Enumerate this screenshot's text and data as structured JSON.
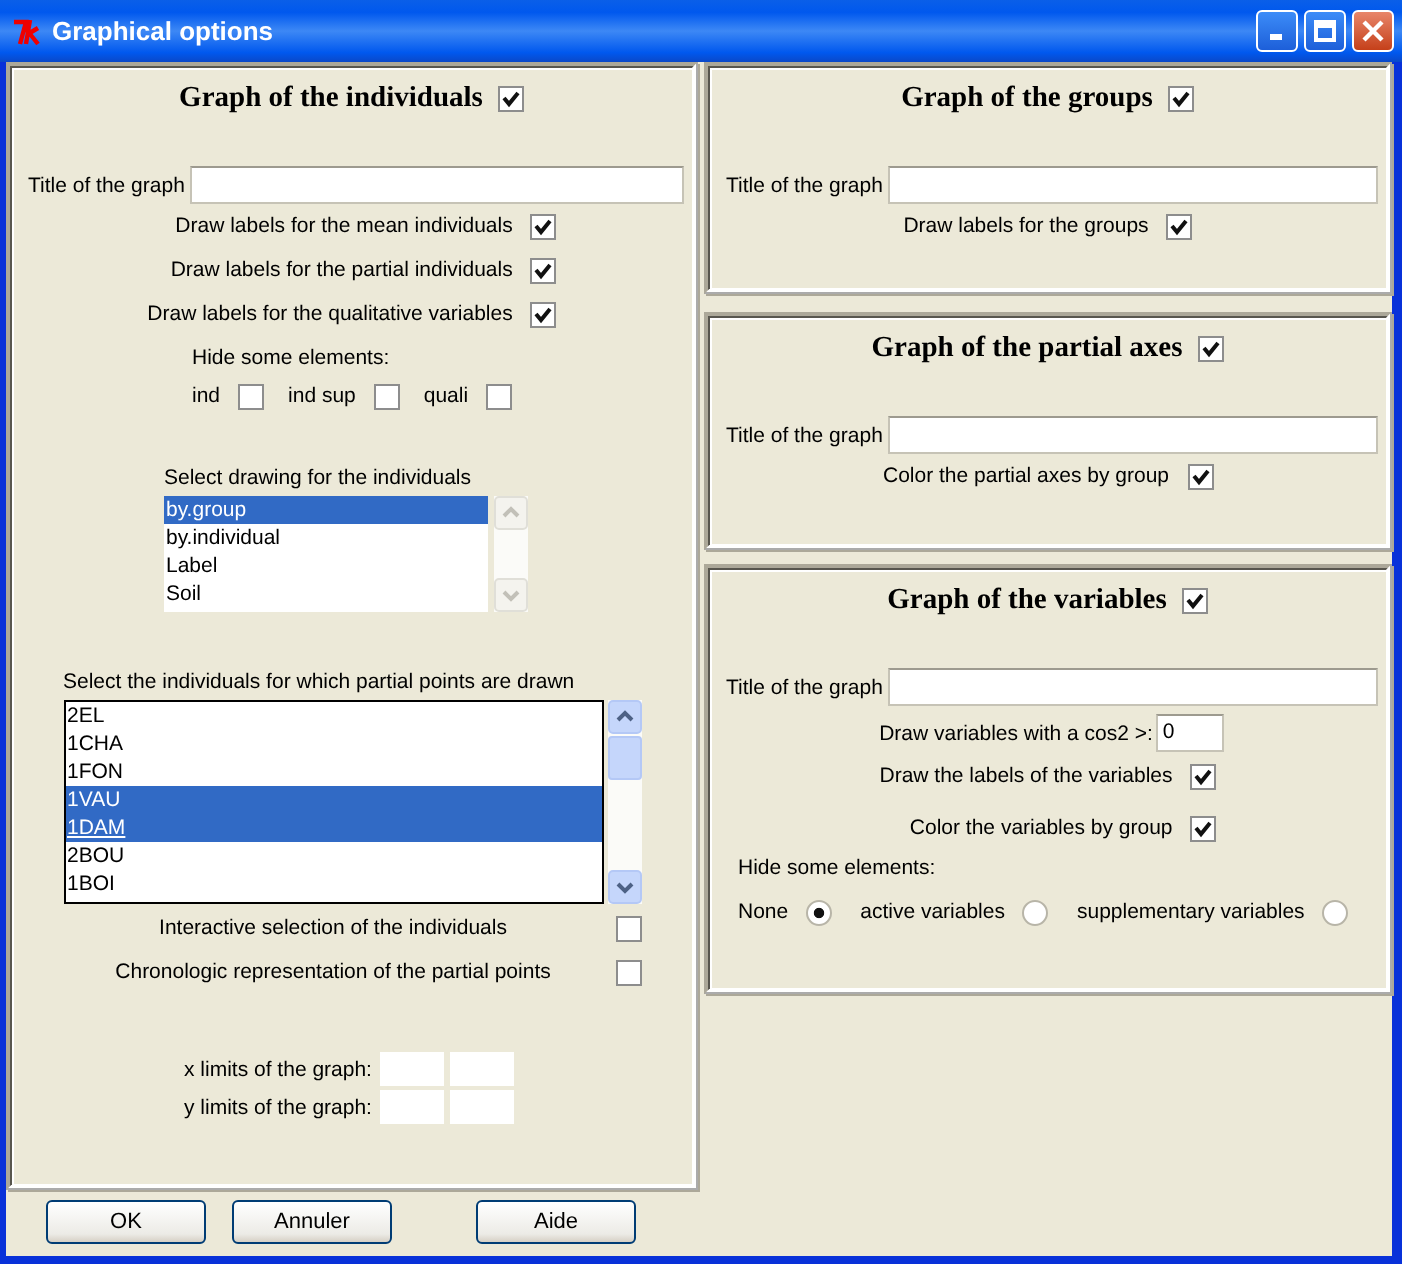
{
  "window": {
    "title": "Graphical options"
  },
  "individuals": {
    "heading": "Graph of the individuals",
    "enabled": true,
    "title_label": "Title of the graph",
    "options": [
      {
        "label": "Draw labels for the mean individuals",
        "checked": true
      },
      {
        "label": "Draw labels for the partial individuals",
        "checked": true
      },
      {
        "label": "Draw labels for the qualitative variables",
        "checked": true
      }
    ],
    "hide_label": "Hide some elements:",
    "hide_options": [
      {
        "label": "ind",
        "checked": false
      },
      {
        "label": "ind sup",
        "checked": false
      },
      {
        "label": "quali",
        "checked": false
      }
    ],
    "drawing_label": "Select drawing for the individuals",
    "drawing_list": [
      {
        "label": "by.group",
        "selected": true
      },
      {
        "label": "by.individual",
        "selected": false
      },
      {
        "label": "Label",
        "selected": false
      },
      {
        "label": "Soil",
        "selected": false
      }
    ],
    "partial_label": "Select the individuals for which partial points are drawn",
    "partial_list": [
      {
        "label": "2EL",
        "selected": false,
        "active": false
      },
      {
        "label": "1CHA",
        "selected": false,
        "active": false
      },
      {
        "label": "1FON",
        "selected": false,
        "active": false
      },
      {
        "label": "1VAU",
        "selected": true,
        "active": false
      },
      {
        "label": "1DAM",
        "selected": true,
        "active": true
      },
      {
        "label": "2BOU",
        "selected": false,
        "active": false
      },
      {
        "label": "1BOI",
        "selected": false,
        "active": false
      }
    ],
    "extra_options": [
      {
        "label": "Interactive selection of the individuals",
        "checked": false
      },
      {
        "label": "Chronologic representation of the partial points",
        "checked": false
      }
    ],
    "limits": [
      {
        "label": "x limits of the graph:"
      },
      {
        "label": "y limits of the graph:"
      }
    ]
  },
  "groups": {
    "heading": "Graph of the groups",
    "enabled": true,
    "title_label": "Title of the graph",
    "options": [
      {
        "label": "Draw labels for the groups",
        "checked": true
      }
    ]
  },
  "partial_axes": {
    "heading": "Graph of the partial axes",
    "enabled": true,
    "title_label": "Title of the graph",
    "options": [
      {
        "label": "Color the partial axes by group",
        "checked": true
      }
    ]
  },
  "variables": {
    "heading": "Graph of the variables",
    "enabled": true,
    "title_label": "Title of the graph",
    "cos2_label": "Draw variables with a cos2 >:",
    "cos2_value": "0",
    "options": [
      {
        "label": "Draw the labels of the variables",
        "checked": true
      },
      {
        "label": "Color the variables by group",
        "checked": true
      }
    ],
    "hide_label": "Hide some elements:",
    "hide_choices": [
      {
        "label": "None",
        "selected": true
      },
      {
        "label": "active variables",
        "selected": false
      },
      {
        "label": "supplementary variables",
        "selected": false
      }
    ]
  },
  "buttons": [
    {
      "label": "OK"
    },
    {
      "label": "Annuler"
    },
    {
      "label": "Aide"
    }
  ]
}
